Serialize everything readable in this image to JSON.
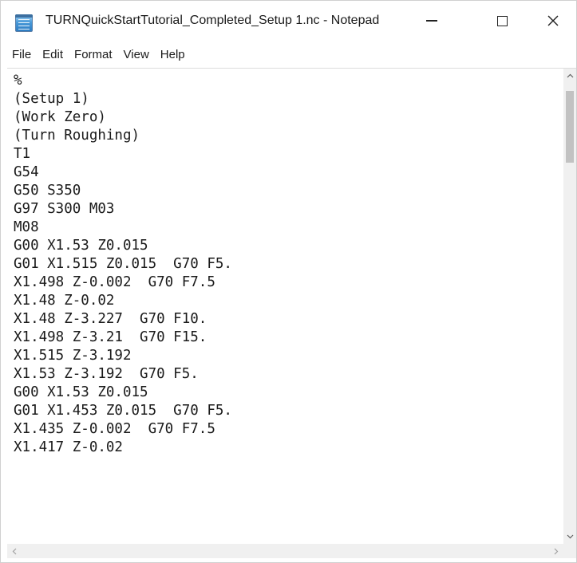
{
  "window": {
    "title": "TURNQuickStartTutorial_Completed_Setup 1.nc - Notepad",
    "app_icon": "notepad-icon",
    "controls": {
      "minimize": "minimize-icon",
      "maximize": "maximize-icon",
      "close_label": "✕"
    }
  },
  "menu": {
    "items": [
      "File",
      "Edit",
      "Format",
      "View",
      "Help"
    ]
  },
  "editor": {
    "lines": [
      "%",
      "(Setup 1)",
      "(Work Zero)",
      "(Turn Roughing)",
      "T1",
      "G54",
      "G50 S350",
      "G97 S300 M03",
      "M08",
      "G00 X1.53 Z0.015",
      "G01 X1.515 Z0.015  G70 F5.",
      "X1.498 Z-0.002  G70 F7.5",
      "X1.48 Z-0.02",
      "X1.48 Z-3.227  G70 F10.",
      "X1.498 Z-3.21  G70 F15.",
      "X1.515 Z-3.192",
      "X1.53 Z-3.192  G70 F5.",
      "G00 X1.53 Z0.015",
      "G01 X1.453 Z0.015  G70 F5.",
      "X1.435 Z-0.002  G70 F7.5",
      "X1.417 Z-0.02"
    ]
  },
  "scrollbars": {
    "up_arrow": "^",
    "down_arrow": "v",
    "left_arrow": "<",
    "right_arrow": ">"
  }
}
